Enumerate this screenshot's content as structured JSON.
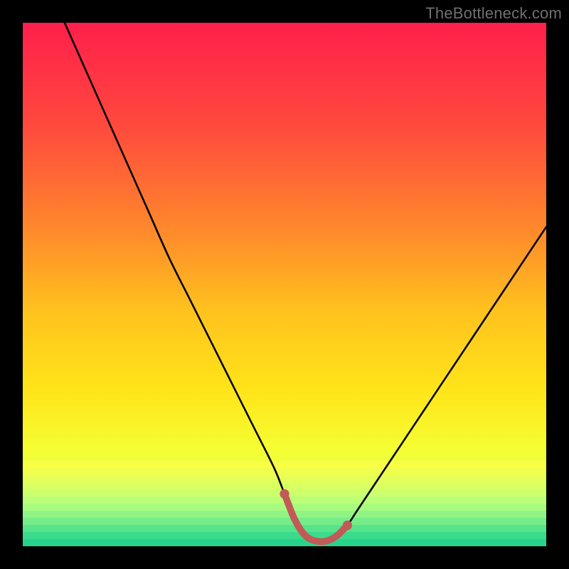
{
  "watermark": {
    "text": "TheBottleneck.com"
  },
  "chart_data": {
    "type": "line",
    "title": "",
    "xlabel": "",
    "ylabel": "",
    "xlim": [
      0,
      100
    ],
    "ylim": [
      0,
      100
    ],
    "optimal_range_x": [
      49,
      62
    ],
    "series": [
      {
        "name": "bottleneck-curve",
        "x": [
          8,
          12,
          16,
          20,
          24,
          28,
          32,
          36,
          40,
          44,
          48,
          50,
          52,
          54,
          56,
          58,
          60,
          62,
          64,
          68,
          72,
          76,
          80,
          84,
          88,
          92,
          96,
          100
        ],
        "y": [
          100,
          91,
          82,
          73,
          64,
          55,
          47,
          39,
          31,
          23,
          15,
          10,
          5,
          2,
          1,
          1,
          2,
          4,
          7,
          13,
          19,
          25,
          31,
          37,
          43,
          49,
          55,
          61
        ]
      }
    ],
    "gradient_stops": [
      {
        "pos": 0.0,
        "color": "#ff1f4b"
      },
      {
        "pos": 0.2,
        "color": "#ff4a3d"
      },
      {
        "pos": 0.4,
        "color": "#ff8a2b"
      },
      {
        "pos": 0.55,
        "color": "#ffc21e"
      },
      {
        "pos": 0.7,
        "color": "#ffe419"
      },
      {
        "pos": 0.82,
        "color": "#f4ff33"
      },
      {
        "pos": 0.88,
        "color": "#d8ff55"
      },
      {
        "pos": 0.92,
        "color": "#a8ff70"
      },
      {
        "pos": 0.96,
        "color": "#66f982"
      },
      {
        "pos": 1.0,
        "color": "#28e38a"
      }
    ],
    "bottom_bands": [
      "#f8ff44",
      "#f0ff4e",
      "#e6ff58",
      "#daff62",
      "#ccff6c",
      "#bcff76",
      "#a8fb7e",
      "#90f485",
      "#75ec89",
      "#56e38b",
      "#3adb8b",
      "#25d48a"
    ],
    "annotations": {
      "optimal_marker_color": "#c25a58",
      "curve_color": "#000000"
    }
  }
}
